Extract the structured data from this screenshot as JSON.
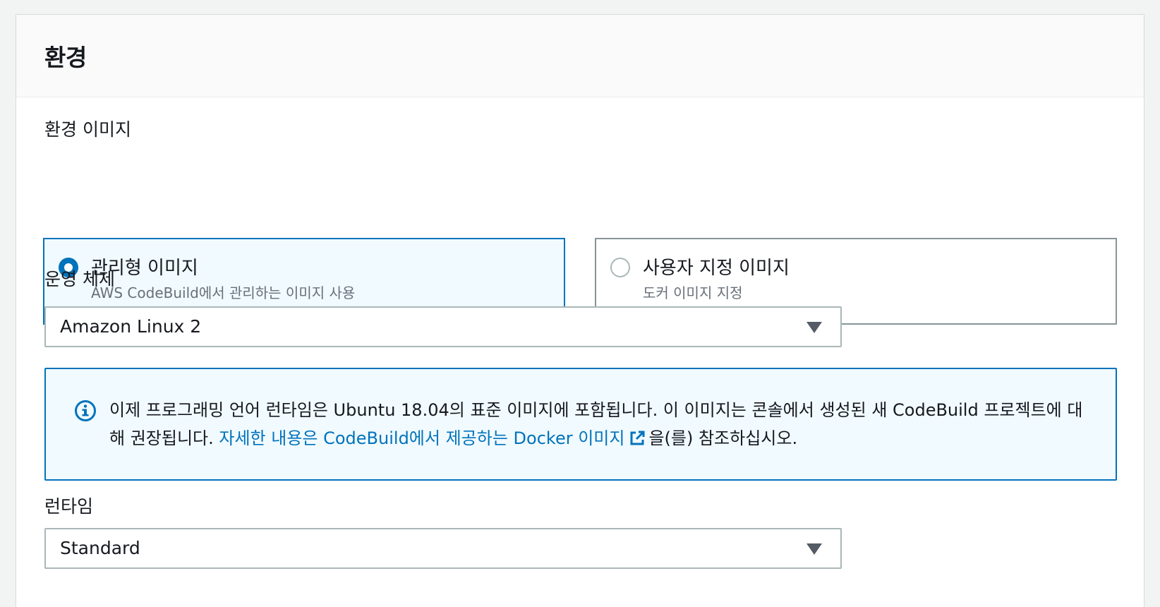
{
  "section": {
    "title": "환경"
  },
  "environment_image": {
    "label": "환경 이미지",
    "options": [
      {
        "title": "관리형 이미지",
        "description": "AWS CodeBuild에서 관리하는 이미지 사용",
        "selected": true
      },
      {
        "title": "사용자 지정 이미지",
        "description": "도커 이미지 지정",
        "selected": false
      }
    ]
  },
  "operating_system": {
    "label": "운영 체제",
    "value": "Amazon Linux 2"
  },
  "info_alert": {
    "icon": "info-icon",
    "text": "이제 프로그래밍 언어 런타임은 Ubuntu 18.04의 표준 이미지에 포함됩니다. 이 이미지는 콘솔에서 생성된 새 CodeBuild 프로젝트에 대해 권장됩니다. ",
    "link_text": "자세한 내용은 CodeBuild에서 제공하는 Docker 이미지",
    "link_icon": "external-link-icon",
    "suffix": "을(를) 참조하십시오."
  },
  "runtime": {
    "label": "런타임",
    "value": "Standard"
  },
  "colors": {
    "accent": "#0073bb",
    "selected_bg": "#f1faff",
    "border": "#aab7b8"
  }
}
